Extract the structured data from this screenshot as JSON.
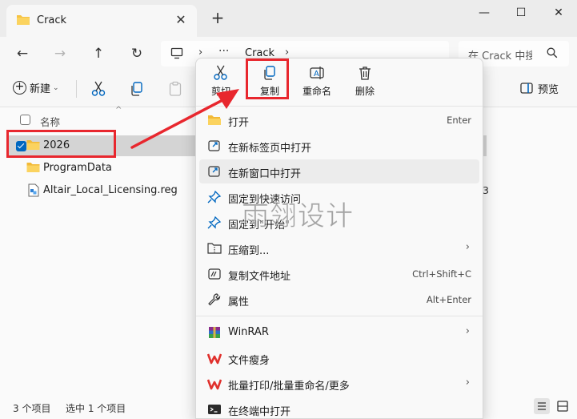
{
  "window": {
    "tab_title": "Crack",
    "minimize_glyph": "—",
    "maximize_glyph": "☐",
    "close_glyph": "✕",
    "tab_close_glyph": "✕",
    "new_tab_glyph": "+"
  },
  "address": {
    "crumb_ellipsis": "···",
    "crumb_current": "Crack",
    "search_placeholder": "在 Crack 中搜"
  },
  "commandbar": {
    "new_label": "新建",
    "preview_label": "预览"
  },
  "columns": {
    "name": "名称"
  },
  "files": [
    {
      "name": "2026",
      "type": "folder",
      "selected": true
    },
    {
      "name": "ProgramData",
      "type": "folder",
      "selected": false
    },
    {
      "name": "Altair_Local_Licensing.reg",
      "type": "reg",
      "selected": false
    }
  ],
  "stray_text": "3",
  "status": {
    "item_count": "3 个项目",
    "selected_count": "选中 1 个项目"
  },
  "context_menu": {
    "quick_actions": [
      {
        "label": "剪切",
        "icon": "scissors-icon"
      },
      {
        "label": "复制",
        "icon": "copy-icon"
      },
      {
        "label": "重命名",
        "icon": "rename-icon"
      },
      {
        "label": "删除",
        "icon": "trash-icon"
      }
    ],
    "items": [
      {
        "label": "打开",
        "shortcut": "Enter",
        "icon": "folder-open-icon"
      },
      {
        "label": "在新标签页中打开",
        "shortcut": "",
        "icon": "new-tab-icon"
      },
      {
        "label": "在新窗口中打开",
        "shortcut": "",
        "icon": "new-window-icon"
      },
      {
        "label": "固定到快速访问",
        "shortcut": "",
        "icon": "pin-icon"
      },
      {
        "label": "固定到\"开始\"",
        "shortcut": "",
        "icon": "pin-start-icon"
      },
      {
        "label": "压缩到...",
        "shortcut": "",
        "icon": "zip-icon",
        "submenu": true
      },
      {
        "label": "复制文件地址",
        "shortcut": "Ctrl+Shift+C",
        "icon": "copy-path-icon"
      },
      {
        "label": "属性",
        "shortcut": "Alt+Enter",
        "icon": "wrench-icon"
      },
      {
        "label": "WinRAR",
        "shortcut": "",
        "icon": "winrar-icon",
        "submenu": true
      },
      {
        "label": "文件瘦身",
        "shortcut": "",
        "icon": "wps-icon"
      },
      {
        "label": "批量打印/批量重命名/更多",
        "shortcut": "",
        "icon": "wps-icon",
        "submenu": true
      },
      {
        "label": "在终端中打开",
        "shortcut": "",
        "icon": "terminal-icon"
      }
    ],
    "submenu_arrow": "›"
  },
  "watermark": "雨翎设计",
  "colors": {
    "accent": "#0067c0",
    "annotation_red": "#e8272e",
    "folder_yellow": "#f6c342",
    "wps_red": "#e0312d"
  }
}
